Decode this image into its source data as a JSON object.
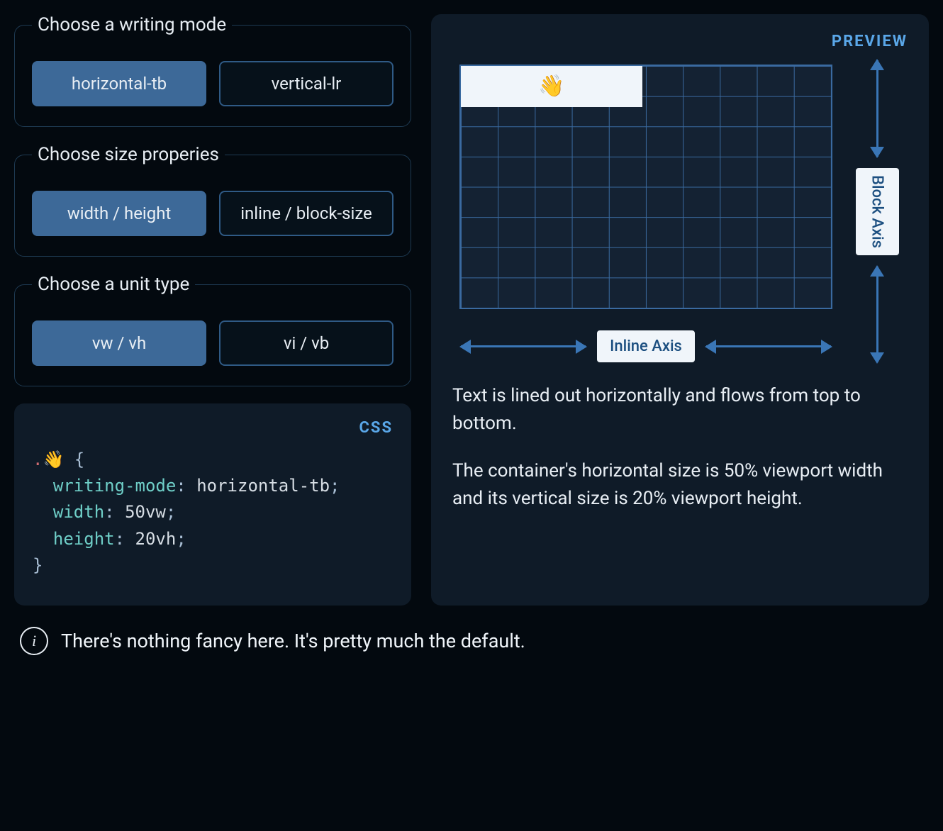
{
  "controls": {
    "writing_mode": {
      "legend": "Choose a writing mode",
      "options": [
        "horizontal-tb",
        "vertical-lr"
      ],
      "selected": 0
    },
    "size_props": {
      "legend": "Choose size properies",
      "options": [
        "width / height",
        "inline / block-size"
      ],
      "selected": 0
    },
    "unit_type": {
      "legend": "Choose a unit type",
      "options": [
        "vw / vh",
        "vi / vb"
      ],
      "selected": 0
    }
  },
  "code": {
    "panel_label": "CSS",
    "selector_dot": ".",
    "selector_emoji": "👋",
    "lines": [
      {
        "prop": "writing-mode",
        "val": "horizontal-tb"
      },
      {
        "prop": "width",
        "val": "50vw"
      },
      {
        "prop": "height",
        "val": "20vh"
      }
    ]
  },
  "preview": {
    "panel_label": "PREVIEW",
    "chip_emoji": "👋",
    "inline_axis_label": "Inline Axis",
    "block_axis_label": "Block Axis",
    "paragraph1": "Text is lined out horizontally and flows from top to bottom.",
    "paragraph2": "The container's horizontal size is 50% viewport width and its vertical size is 20% viewport height."
  },
  "footer": {
    "text": "There's nothing fancy here. It's pretty much the default."
  }
}
